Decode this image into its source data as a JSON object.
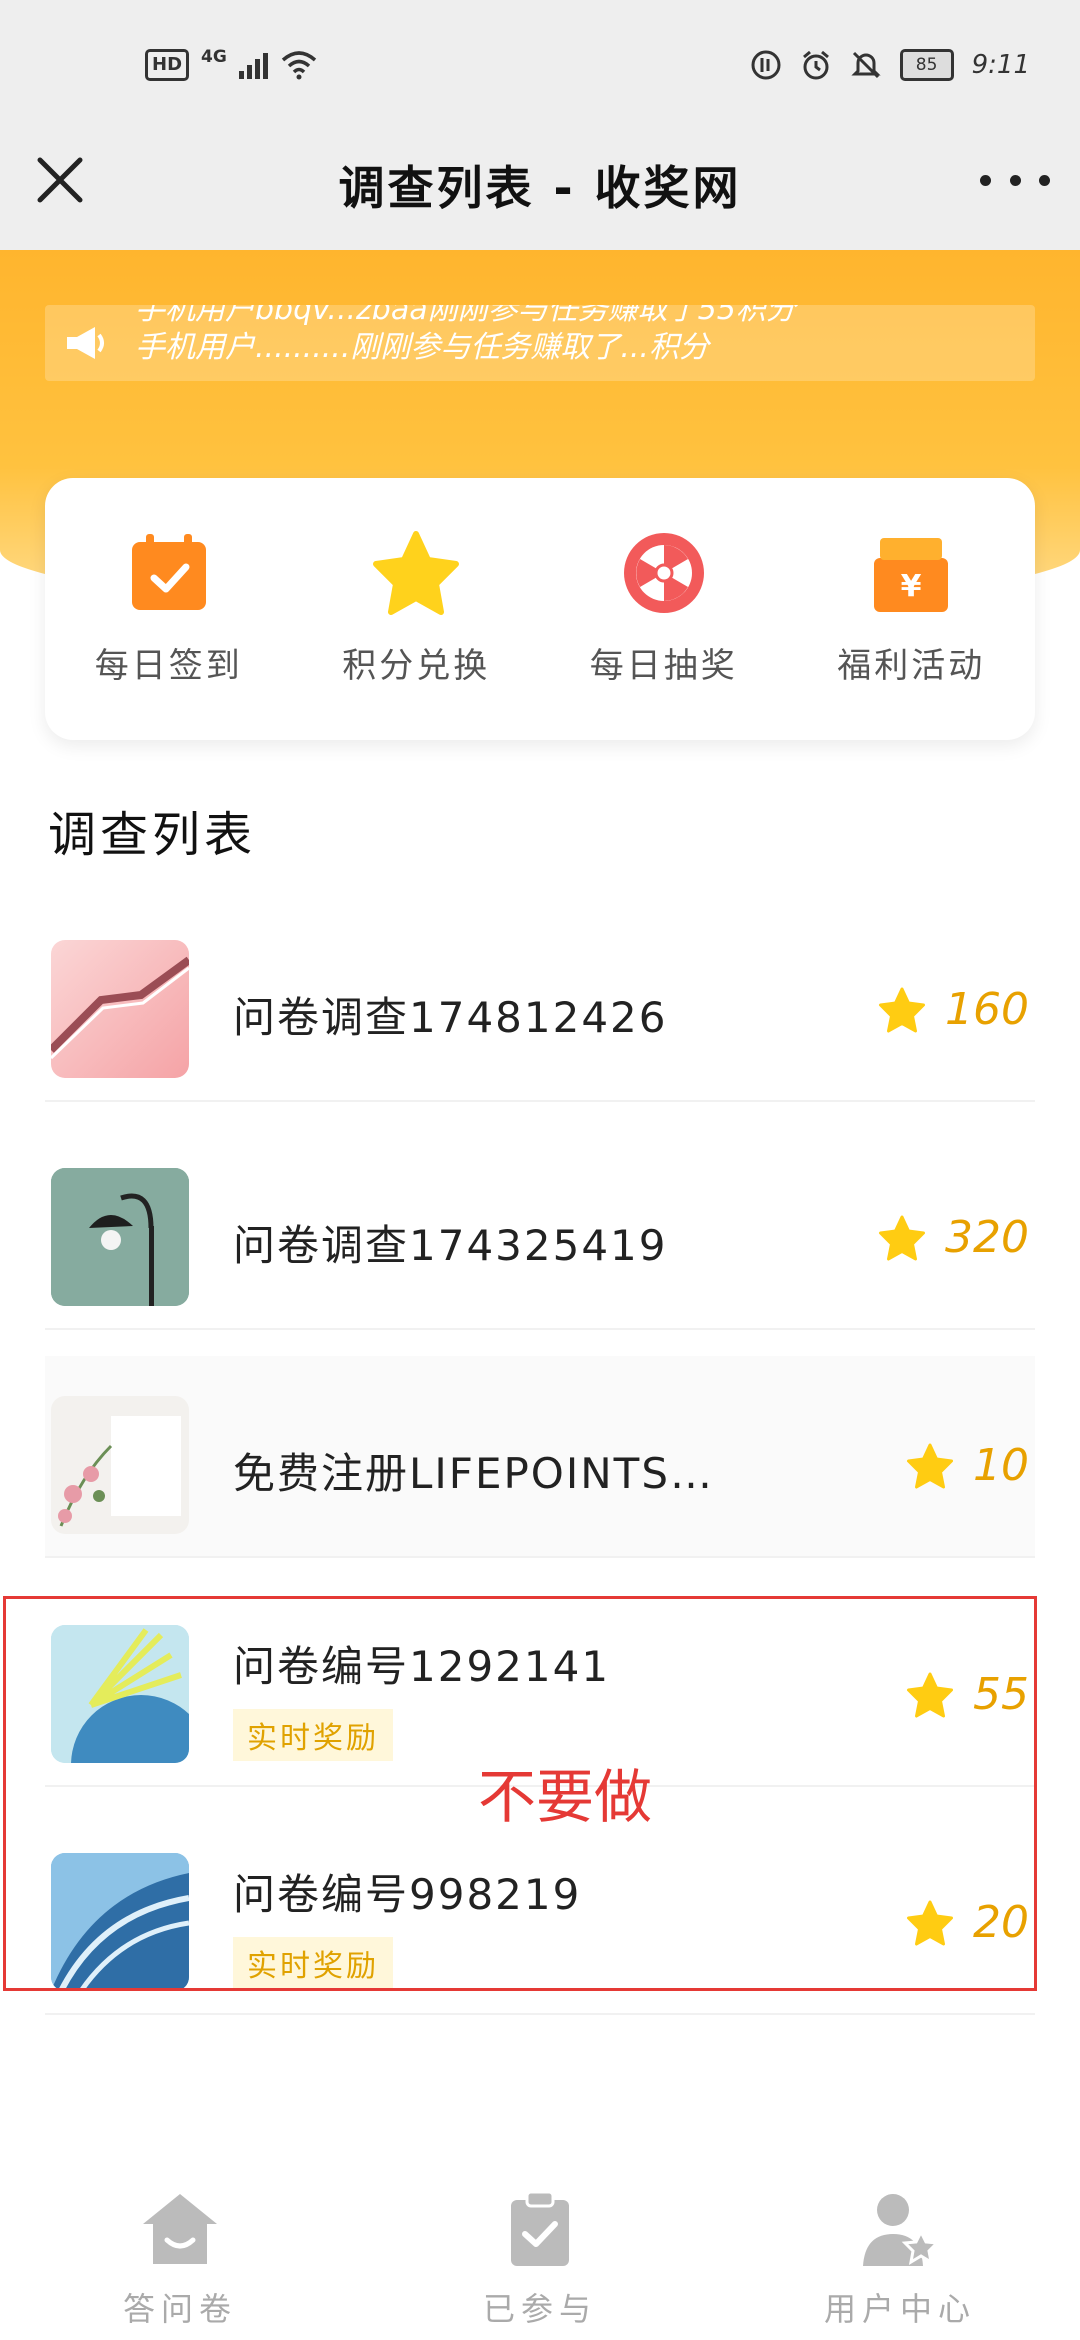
{
  "status_bar": {
    "left_badges": [
      "HD",
      "4G"
    ],
    "battery": "85",
    "time": "9:11"
  },
  "nav": {
    "title": "调查列表 - 收奖网"
  },
  "ticker": {
    "lines": [
      "手机用户bbqv...zbaa刚刚参与任务赚取了55积分",
      "手机用户..........刚刚参与任务赚取了...积分"
    ]
  },
  "quick_actions": [
    {
      "label": "每日签到",
      "icon": "calendar-check-icon"
    },
    {
      "label": "积分兑换",
      "icon": "star-icon"
    },
    {
      "label": "每日抽奖",
      "icon": "lucky-wheel-icon"
    },
    {
      "label": "福利活动",
      "icon": "gift-box-icon"
    }
  ],
  "section_title": "调查列表",
  "surveys": [
    {
      "title": "问卷调查174812426",
      "points": "160",
      "badge": ""
    },
    {
      "title": "问卷调查174325419",
      "points": "320",
      "badge": ""
    },
    {
      "title": "免费注册LIFEPOINTS…",
      "points": "10",
      "badge": ""
    },
    {
      "title": "问卷编号1292141",
      "points": "55",
      "badge": "实时奖励"
    },
    {
      "title": "问卷编号998219",
      "points": "20",
      "badge": "实时奖励"
    }
  ],
  "annotation": "不要做",
  "tabs": [
    {
      "label": "答问卷",
      "icon": "home-icon"
    },
    {
      "label": "已参与",
      "icon": "clipboard-check-icon"
    },
    {
      "label": "用户中心",
      "icon": "user-star-icon"
    }
  ],
  "colors": {
    "accent": "#ffb52e",
    "points": "#e8a100",
    "annotation": "#e53935"
  }
}
